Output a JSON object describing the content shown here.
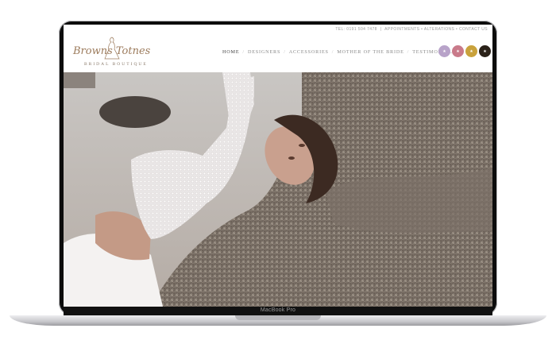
{
  "device": {
    "model_label": "MacBook Pro"
  },
  "site": {
    "topbar": {
      "phone": "TEL: 0191 504 7478",
      "separator": "|",
      "links": "APPOINTMENTS • ALTERATIONS • CONTACT US"
    },
    "logo": {
      "script": "Browns Totnes",
      "subtitle": "BRIDAL BOUTIQUE"
    },
    "nav": [
      "HOME",
      "DESIGNERS",
      "ACCESSORIES",
      "MOTHER OF THE BRIDE",
      "TESTIMONIALS"
    ],
    "nav_separator": "/",
    "badges": [
      {
        "icon": "award-badge-icon",
        "color": "#b8a3c9"
      },
      {
        "icon": "award-badge-icon",
        "color": "#c97a8a"
      },
      {
        "icon": "award-badge-icon",
        "color": "#c9a23c"
      },
      {
        "icon": "award-badge-icon",
        "color": "#2a2118"
      }
    ]
  }
}
